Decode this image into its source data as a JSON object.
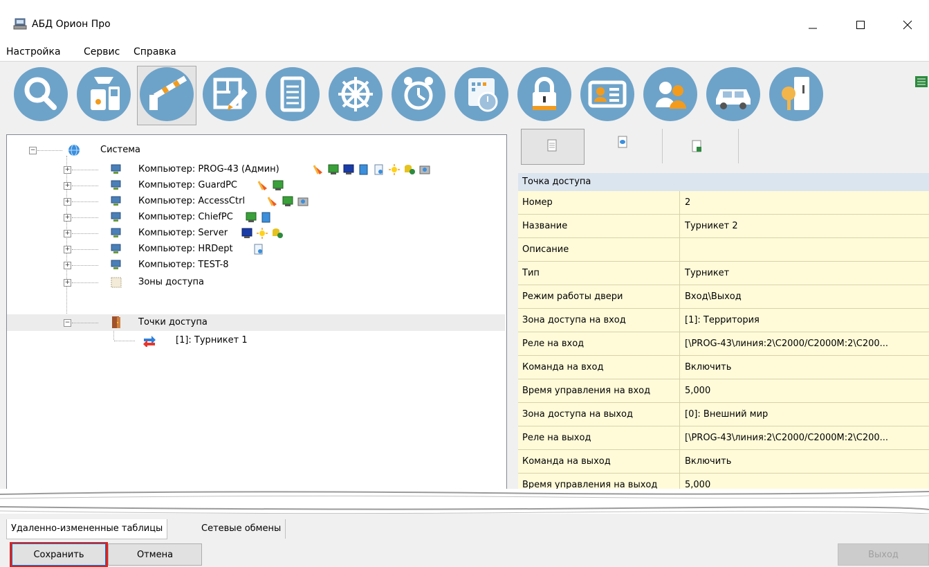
{
  "window": {
    "title": "АБД Орион Про"
  },
  "menu": [
    "Настройка",
    "Сервис",
    "Справка"
  ],
  "toolbar": {
    "tools": [
      "search-icon",
      "devices-icon",
      "barrier-icon",
      "plan-edit-icon",
      "list-icon",
      "wheel-icon",
      "alarm-clock-icon",
      "schedule-icon",
      "lock-icon",
      "id-card-icon",
      "users-icon",
      "car-icon",
      "key-icon"
    ],
    "active_index": 2
  },
  "tree": {
    "root": "Система",
    "computers": [
      {
        "label": "Компьютер: PROG-43 (Админ)"
      },
      {
        "label": "Компьютер: GuardPC"
      },
      {
        "label": "Компьютер: AccessCtrl"
      },
      {
        "label": "Компьютер: ChiefPC"
      },
      {
        "label": "Компьютер: Server"
      },
      {
        "label": "Компьютер: HRDept"
      },
      {
        "label": "Компьютер: TEST-8"
      }
    ],
    "zones": "Зоны доступа",
    "access_points": "Точки доступа",
    "child": "[1]: Турникет 1"
  },
  "props": {
    "header": "Точка доступа",
    "rows": [
      {
        "k": "Номер",
        "v": "2"
      },
      {
        "k": "Название",
        "v": "Турникет 2"
      },
      {
        "k": "Описание",
        "v": ""
      },
      {
        "k": "Тип",
        "v": "Турникет"
      },
      {
        "k": "Режим работы двери",
        "v": "Вход\\Выход"
      },
      {
        "k": "Зона доступа на вход",
        "v": "[1]: Территория"
      },
      {
        "k": "Реле на вход",
        "v": "[\\PROG-43\\линия:2\\С2000/С2000М:2\\С200..."
      },
      {
        "k": "Команда на вход",
        "v": "Включить"
      },
      {
        "k": "Время управления на вход",
        "v": "5,000"
      },
      {
        "k": "Зона доступа на выход",
        "v": "[0]: Внешний мир"
      },
      {
        "k": "Реле на выход",
        "v": "[\\PROG-43\\линия:2\\С2000/С2000М:2\\С200..."
      },
      {
        "k": "Команда на выход",
        "v": "Включить"
      },
      {
        "k": "Время управления на выход",
        "v": "5,000"
      }
    ]
  },
  "bottom_tabs": [
    "Удаленно-измененные таблицы",
    "Сетевые обмены"
  ],
  "buttons": {
    "save": "Сохранить",
    "cancel": "Отмена",
    "exit": "Выход"
  },
  "colors": {
    "highlight_border": "#e0201c",
    "prop_bg": "#fffbd9",
    "tool_blue": "#6ea3c9"
  }
}
